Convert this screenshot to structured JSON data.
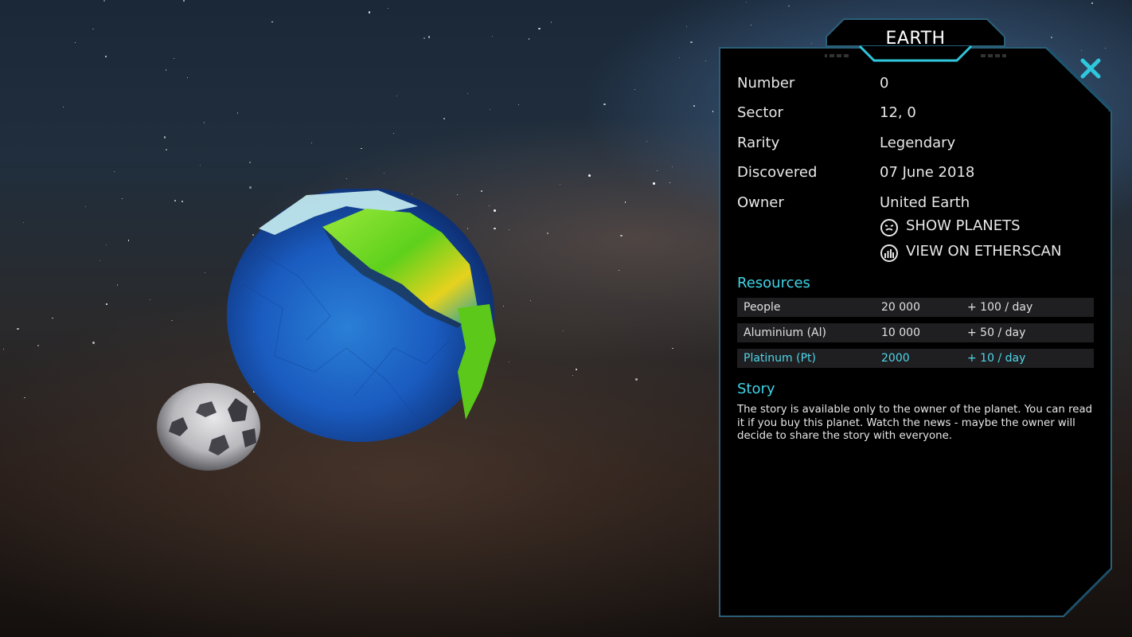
{
  "panel": {
    "title": "EARTH",
    "close_icon": "close-x-icon",
    "accent_color": "#2fc7dc",
    "info": [
      {
        "label": "Number",
        "value": "0"
      },
      {
        "label": "Sector",
        "value": "12, 0"
      },
      {
        "label": "Rarity",
        "value": "Legendary"
      },
      {
        "label": "Discovered",
        "value": "07 June 2018"
      },
      {
        "label": "Owner",
        "value": "United Earth"
      }
    ],
    "actions": {
      "show_planets": {
        "label": "SHOW PLANETS",
        "icon": "planet-face-icon"
      },
      "view_etherscan": {
        "label": "VIEW ON ETHERSCAN",
        "icon": "etherscan-icon"
      }
    },
    "resources_title": "Resources",
    "resources": [
      {
        "name": "People",
        "amount": "20 000",
        "rate": "+ 100 / day"
      },
      {
        "name": "Aluminium (Al)",
        "amount": "10 000",
        "rate": "+ 50 / day"
      },
      {
        "name": "Platinum (Pt)",
        "amount": "2000",
        "rate": "+ 10 / day",
        "highlight": true
      }
    ],
    "story_title": "Story",
    "story_text": "The story is available only to the owner of the planet. You can read it if you buy this planet. Watch the news - maybe the owner will decide to share the story with everyone."
  }
}
